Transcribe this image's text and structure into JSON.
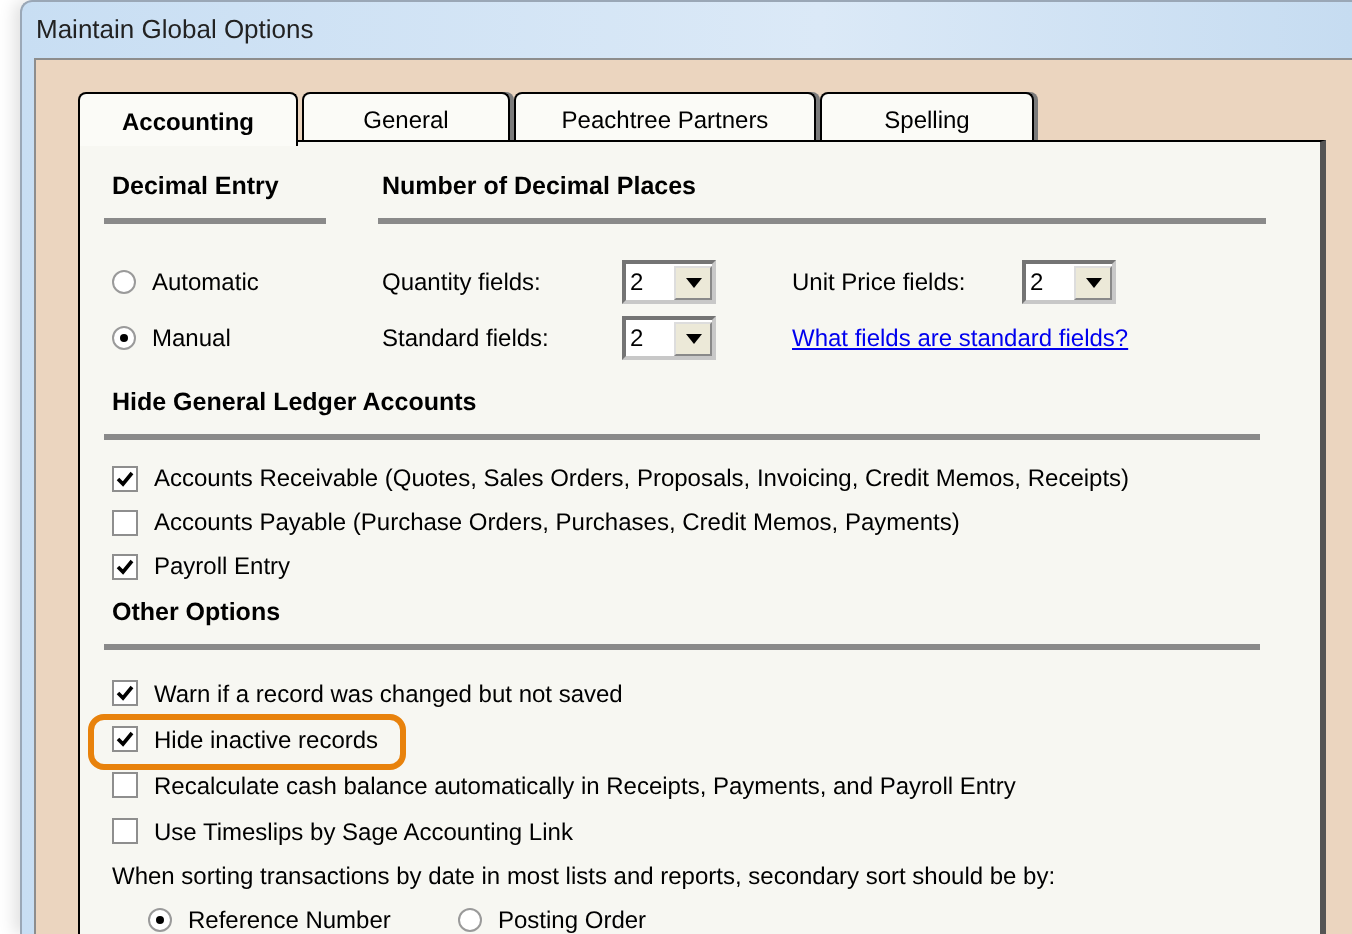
{
  "window": {
    "title": "Maintain Global Options"
  },
  "tabs": [
    {
      "label": "Accounting",
      "selected": true
    },
    {
      "label": "General",
      "selected": false
    },
    {
      "label": "Peachtree Partners",
      "selected": false
    },
    {
      "label": "Spelling",
      "selected": false
    }
  ],
  "decimal_entry": {
    "heading": "Decimal Entry",
    "options": [
      {
        "label": "Automatic",
        "selected": false
      },
      {
        "label": "Manual",
        "selected": true
      }
    ]
  },
  "decimal_places": {
    "heading": "Number of Decimal Places",
    "fields": [
      {
        "label": "Quantity fields:",
        "value": "2"
      },
      {
        "label": "Unit Price fields:",
        "value": "2"
      },
      {
        "label": "Standard fields:",
        "value": "2"
      }
    ],
    "link": "What fields are standard fields?"
  },
  "hide_gl_accounts": {
    "heading": "Hide General Ledger Accounts",
    "options": [
      {
        "label": "Accounts Receivable (Quotes, Sales Orders, Proposals, Invoicing, Credit Memos, Receipts)",
        "checked": true
      },
      {
        "label": "Accounts Payable (Purchase Orders, Purchases, Credit Memos, Payments)",
        "checked": false
      },
      {
        "label": "Payroll Entry",
        "checked": true
      }
    ]
  },
  "other_options": {
    "heading": "Other Options",
    "options": [
      {
        "label": "Warn if a record was changed but not saved",
        "checked": true,
        "highlighted": false
      },
      {
        "label": "Hide inactive records",
        "checked": true,
        "highlighted": true
      },
      {
        "label": "Recalculate cash balance automatically in Receipts, Payments, and Payroll Entry",
        "checked": false,
        "highlighted": false
      },
      {
        "label": "Use Timeslips by Sage Accounting Link",
        "checked": false,
        "highlighted": false
      }
    ],
    "sort_prompt": "When sorting transactions by date in most lists and reports, secondary sort should be by:",
    "sort_options": [
      {
        "label": "Reference Number",
        "selected": true
      },
      {
        "label": "Posting Order",
        "selected": false
      }
    ]
  }
}
